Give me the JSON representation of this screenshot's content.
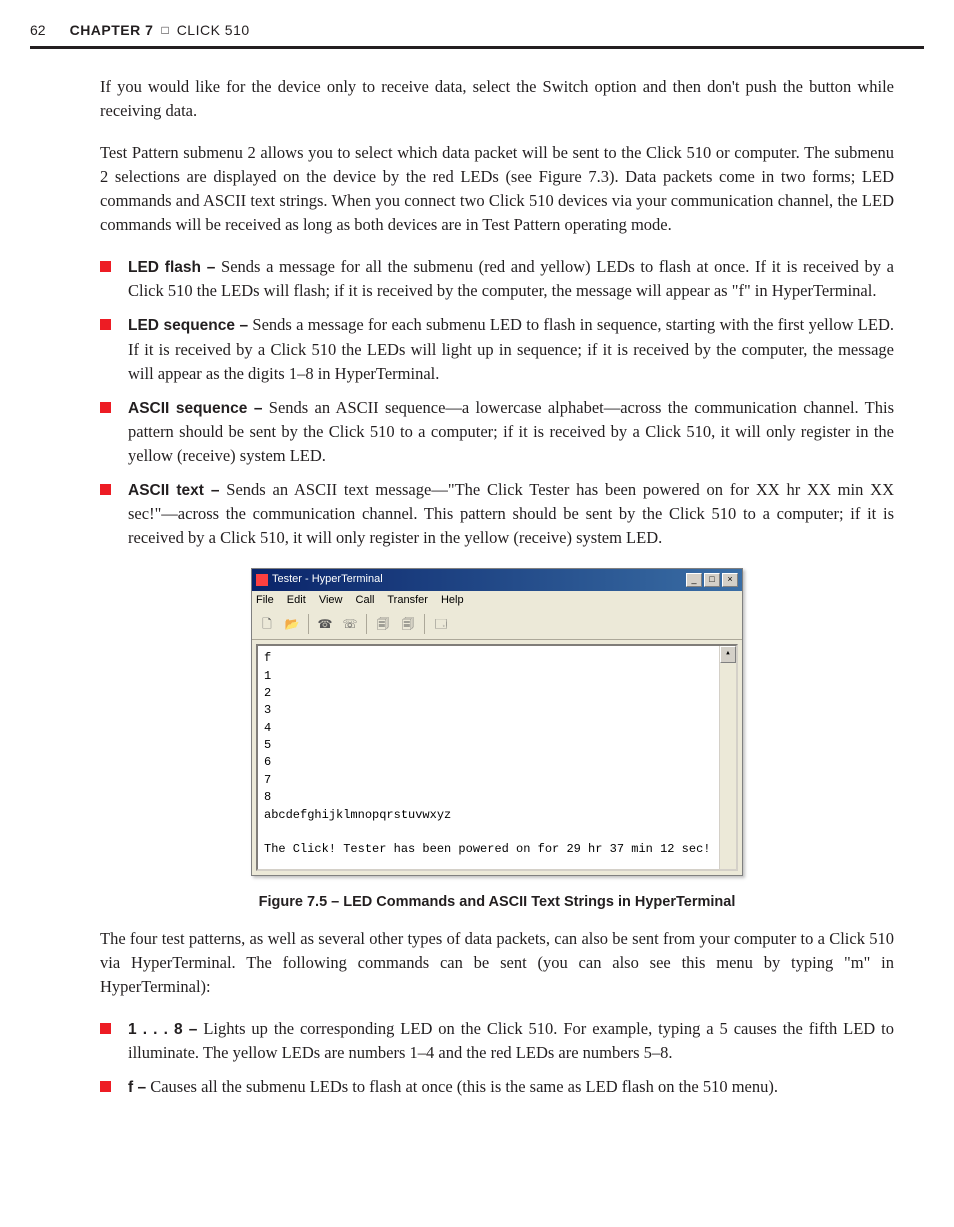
{
  "header": {
    "page_num": "62",
    "chapter_label": "CHAPTER 7",
    "separator": "□",
    "chapter_title": "CLICK 510"
  },
  "intro_para_1": "If you would like for the device only to receive data, select the Switch option and then don't push the button while receiving data.",
  "intro_para_2": "Test Pattern submenu 2 allows you to select which data packet will be sent to the Click 510 or computer. The submenu 2 selections are displayed on the device by the red LEDs (see Figure 7.3). Data packets come in two forms; LED commands and ASCII text strings. When you connect two Click 510 devices via your communication channel, the LED commands will be received as long as both devices are in Test Pattern operating mode.",
  "bullets_a": [
    {
      "term": "LED flash –",
      "text": " Sends a message for all the submenu (red and yellow) LEDs to flash at once. If it is received by a Click 510 the LEDs will flash; if it is received by the computer, the message will appear as \"f\" in HyperTerminal."
    },
    {
      "term": "LED sequence –",
      "text": " Sends a message for each submenu LED to flash in sequence, starting with the first yellow LED. If it is received by a Click 510 the LEDs will light up in sequence; if it is received by the computer, the message will appear as the digits 1–8 in HyperTerminal."
    },
    {
      "term": "ASCII sequence –",
      "text": " Sends an ASCII sequence—a lowercase alphabet—across the communication channel. This pattern should be sent by the Click 510 to a computer; if it is received by a Click 510, it will only register in the yellow (receive) system LED."
    },
    {
      "term": "ASCII text –",
      "text": " Sends an ASCII text message—\"The Click Tester has been powered on for XX hr XX min XX sec!\"—across the communication channel. This pattern should be sent by the Click 510 to a computer; if it is received by a Click 510, it will only register in the yellow (receive) system LED."
    }
  ],
  "figure": {
    "window_title": "Tester - HyperTerminal",
    "menus": [
      "File",
      "Edit",
      "View",
      "Call",
      "Transfer",
      "Help"
    ],
    "terminal_text": "f\n1\n2\n3\n4\n5\n6\n7\n8\nabcdefghijklmnopqrstuvwxyz\n\nThe Click! Tester has been powered on for 29 hr 37 min 12 sec!",
    "caption": "Figure 7.5 – LED Commands and ASCII Text Strings in HyperTerminal"
  },
  "after_fig_para": "The four test patterns, as well as several other types of data packets, can also be sent from your computer to a Click 510 via HyperTerminal. The following commands can be sent (you can also see this menu by typing \"m\" in HyperTerminal):",
  "bullets_b": [
    {
      "term": "1 . . . 8 –",
      "text": " Lights up the corresponding LED on the Click 510. For example, typing a 5 causes the fifth LED to illuminate. The yellow LEDs are numbers 1–4 and the red LEDs are numbers 5–8."
    },
    {
      "term": "f –",
      "text": " Causes all the submenu LEDs to flash at once (this is the same as LED flash on the 510 menu)."
    }
  ]
}
